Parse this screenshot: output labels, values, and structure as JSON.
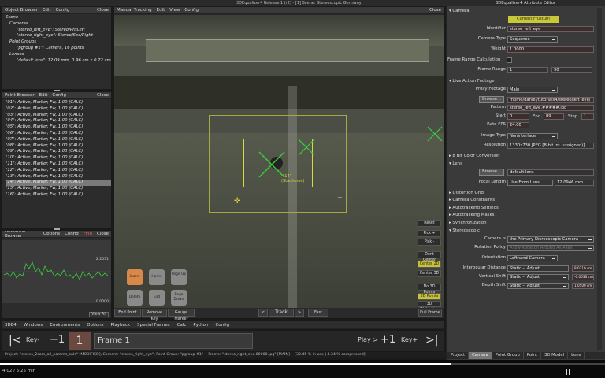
{
  "window": {
    "title": "3DEqualizer4 Release 1 (r2) - [1] Scene: Stereoscopic Germany"
  },
  "object_browser": {
    "menu": [
      "Object Browser",
      "Edit",
      "Config"
    ],
    "close": "Close",
    "tree": [
      "Scene",
      "Cameras",
      "\"stereo_left_eye\": Stereo/Pri/Left",
      "\"stereo_right_eye\": Stereo/Sec/Right",
      "Point Groups",
      "\"pgroup #1\": Camera, 16 points",
      "Lenses",
      "\"default lens\": 12.09 mm, 0.96 cm x 0.72 cm"
    ]
  },
  "point_browser": {
    "menu": [
      "Point Browser",
      "Edit",
      "Config"
    ],
    "close": "Close",
    "points": [
      "\"01\": Active, Marker, Fw, 1.00 (CALC)",
      "\"02\": Active, Marker, Fw, 1.00 (CALC)",
      "\"03\": Active, Marker, Fw, 1.00 (CALC)",
      "\"04\": Active, Marker, Fw, 1.00 (CALC)",
      "\"05\": Active, Marker, Fw, 1.00 (CALC)",
      "\"06\": Active, Marker, Fw, 1.00 (CALC)",
      "\"07\": Active, Marker, Fw, 1.00 (CALC)",
      "\"08\": Active, Marker, Fw, 1.00 (CALC)",
      "\"09\": Active, Marker, Fw, 1.00 (CALC)",
      "\"10\": Active, Marker, Fw, 1.00 (CALC)",
      "\"11\": Active, Marker, Fw, 1.00 (CALC)",
      "\"12\": Active, Marker, Fw, 1.00 (CALC)",
      "\"13\": Active, Marker, Fw, 1.00 (CALC)",
      "\"14\": Active, Marker, Fw, 1.00 (CALC)",
      "\"15\": Active, Marker, Fw, 1.00 (CALC)",
      "\"16\": Active, Marker, Fw, 1.00 (CALC)"
    ]
  },
  "deviation_browser": {
    "menu": [
      "Deviation Browser",
      "Options",
      "Config",
      "Find"
    ],
    "close": "Close",
    "max": "2.2031",
    "min": "0.0000",
    "view_all": "View All"
  },
  "tracking": {
    "menu": [
      "Manual Tracking",
      "Edit",
      "View",
      "Config"
    ],
    "close": "Close",
    "point_label": "\"14\"",
    "point_sub": "(Stadhome)",
    "right_buttons": [
      "Reset",
      "Pick +",
      "Pick -",
      "Dont Center",
      "Center 2D",
      "Center 3D",
      "No 3D Points",
      "3D Points",
      "3D Distortion",
      "Full Frame"
    ],
    "round_buttons": [
      "Insert",
      "Home",
      "Page Up",
      "Delete",
      "End",
      "Page Down"
    ],
    "bottom": [
      "End Point",
      "Remove Key",
      "Gauge Marker"
    ],
    "track": "Track",
    "prev": "<",
    "next": ">",
    "fast": "Fast"
  },
  "app_menu": [
    "3DE4",
    "Windows",
    "Environments",
    "Options",
    "Playback",
    "Special Frames",
    "Calc",
    "Python",
    "Config"
  ],
  "timeline": {
    "first": "|<",
    "key_minus": "Key-",
    "minus1": "−1",
    "frame_num": "1",
    "frame": "Frame 1",
    "play": "Play >",
    "plus1": "+1",
    "key_plus": "Key+",
    "last": ">|"
  },
  "status": "Project: \"stereo_2cam_all_params_calc\" [MODIFIED], Camera: \"stereo_right_eye\", Point Group: \"pgroup #1\" -- Frame: \"stereo_right_eye.00000.jpg\" [MAIN] -- [32.45 % in use | 4.34 % compressed]",
  "video": {
    "time": "4:02 / 5:25 min"
  },
  "attr": {
    "title": "3DEqualizer4 Attribute Editor",
    "camera_section": "Camera",
    "current_frustum": "Current Frustum",
    "identifier_lbl": "Identifier",
    "identifier": "stereo_left_eye",
    "camera_type_lbl": "Camera Type",
    "camera_type": "Sequence",
    "weight_lbl": "Weight",
    "weight": "1.0000",
    "frc_lbl": "Frame Range Calculation",
    "frame_range_lbl": "Frame Range",
    "frame_start": "1",
    "frame_end": "90",
    "live_action": "Live Action Footage",
    "proxy_lbl": "Proxy Footage",
    "proxy": "Main",
    "browse": "Browse...",
    "path": "/home/daniel/tutorials4/stereo/left_eye/",
    "pattern_lbl": "Pattern",
    "pattern": "stereo_left_eye.#####.jpg",
    "start_lbl": "Start",
    "start": "0",
    "end_lbl": "End",
    "end": "89",
    "step_lbl": "Step",
    "step": "1",
    "fps_lbl": "Rate FPS",
    "fps": "24.00",
    "image_type_lbl": "Image Type",
    "image_type": "Noninterlace",
    "resolution_lbl": "Resolution",
    "resolution": "1330x730 JPEG [8-bit int (unsigned)]",
    "bit8": "8 Bit Color Conversion",
    "lens_section": "Lens",
    "lens_browse": "Browse...",
    "lens_name": "default lens",
    "focal_lbl": "Focal Length",
    "focal_mode": "Use From Lens",
    "focal": "12.0946 mm",
    "sections": [
      "Distortion Grid",
      "Camera Constraints",
      "Autotracking Settings",
      "Autotracking Masks",
      "Synchronization",
      "Stereoscopic"
    ],
    "cam_lbl": "Camera is",
    "cam": "the Primary Stereoscopic Camera",
    "rot_lbl": "Rotation Policy",
    "rot": "Allow Rotation Around All Axes",
    "orient_lbl": "Orientation",
    "orient": "Lefthand Camera",
    "io_lbl": "Interocular Distance",
    "io_mode": "Static -- Adjust",
    "io": "8.0310 cm",
    "vs_lbl": "Vertical Shift",
    "vs_mode": "Static -- Adjust",
    "vs": "-0.0636 cm",
    "ds_lbl": "Depth Shift",
    "ds_mode": "Static -- Adjust",
    "ds": "1.0500 cm",
    "tabs": [
      "Project",
      "Camera",
      "Point Group",
      "Point",
      "3D Model",
      "Lens"
    ]
  }
}
